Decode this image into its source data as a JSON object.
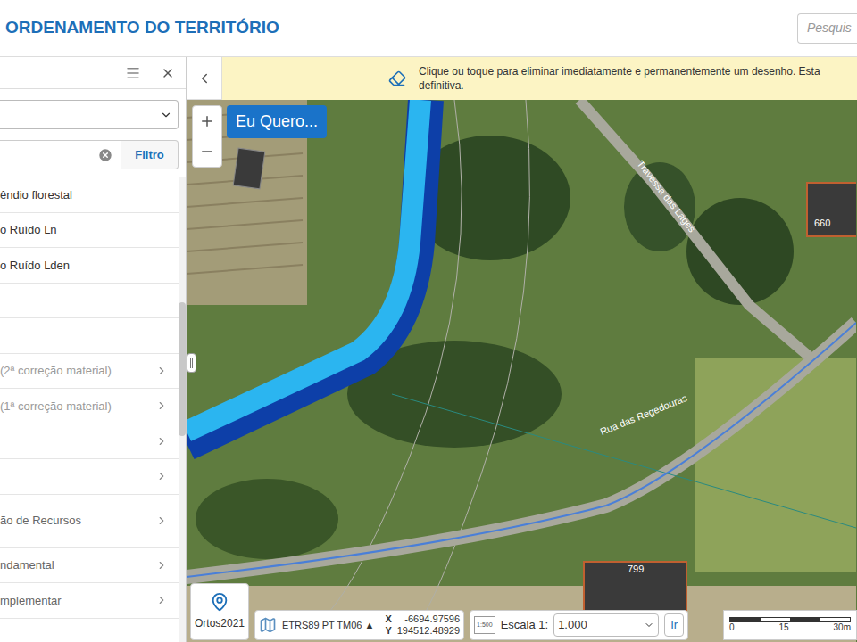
{
  "header": {
    "title": "ORDENAMENTO DO TERRITÓRIO",
    "search_placeholder": "Pesquis"
  },
  "sidebar": {
    "filter_button": "Filtro",
    "items": [
      {
        "label": "êndio florestal",
        "kind": "layer",
        "disabled": false
      },
      {
        "label": "o Ruído Ln",
        "kind": "layer",
        "disabled": false
      },
      {
        "label": "o Ruído Lden",
        "kind": "layer",
        "disabled": false
      },
      {
        "label": "",
        "kind": "layer",
        "disabled": false
      },
      {
        "label": "",
        "kind": "layer",
        "disabled": false
      },
      {
        "label": "(2ª correção material)",
        "kind": "group",
        "disabled": true
      },
      {
        "label": "(1ª correção material)",
        "kind": "group",
        "disabled": true
      },
      {
        "label": "",
        "kind": "group",
        "disabled": false
      },
      {
        "label": "",
        "kind": "group",
        "disabled": false
      },
      {
        "label": "ão de Recursos",
        "kind": "group",
        "disabled": false
      },
      {
        "label": "ndamental",
        "kind": "group",
        "disabled": false
      },
      {
        "label": "mplementar",
        "kind": "group",
        "disabled": false
      }
    ]
  },
  "banner": {
    "lines": [
      "Clique ou toque para eliminar imediatamente e permanentemente um desenho. Esta",
      "definitiva."
    ]
  },
  "map": {
    "action_button": "Eu Quero...",
    "street_labels": [
      "Travessa das Lages",
      "Rua das Regedouras"
    ],
    "building_numbers": [
      "660",
      "799"
    ]
  },
  "status_bar": {
    "basemap": "Ortos2021",
    "crs": "ETRS89 PT TM06 ▲",
    "x_label": "X",
    "x": "-6694.97596",
    "y_label": "Y",
    "y": "194512.48929",
    "scale_icon": "1:500",
    "scale_label": "Escala 1:",
    "scale_value": "1.000",
    "go_button": "Ir",
    "scale_bar": [
      "0",
      "15",
      "30m"
    ]
  }
}
